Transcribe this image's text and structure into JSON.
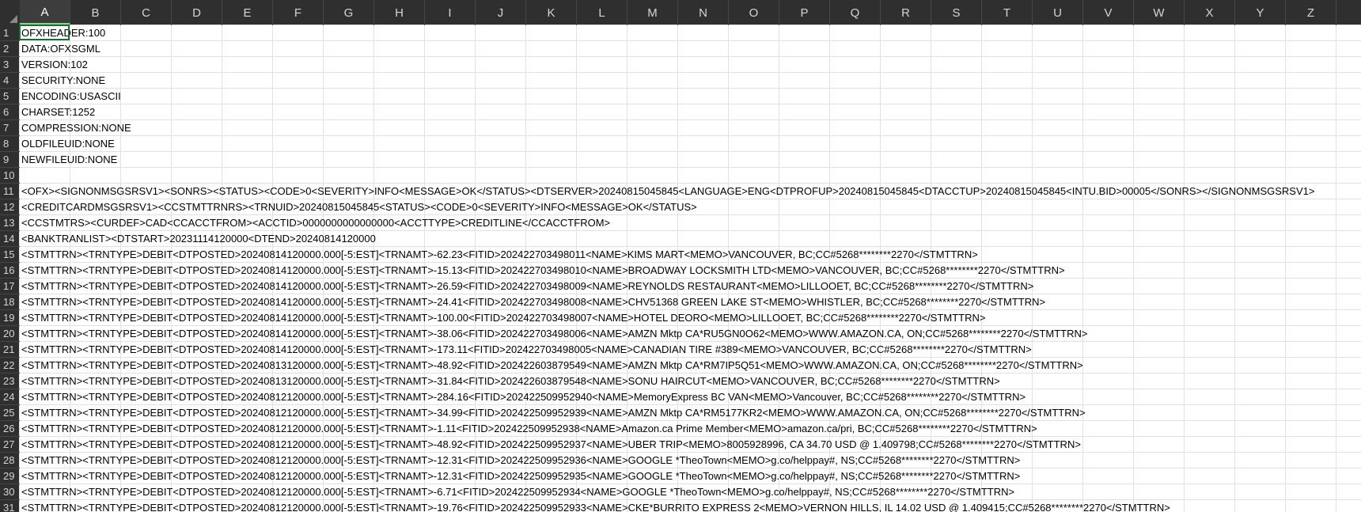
{
  "columns": [
    "A",
    "B",
    "C",
    "D",
    "E",
    "F",
    "G",
    "H",
    "I",
    "J",
    "K",
    "L",
    "M",
    "N",
    "O",
    "P",
    "Q",
    "R",
    "S",
    "T",
    "U",
    "V",
    "W",
    "X",
    "Y",
    "Z"
  ],
  "selected_column": "A",
  "selected_cell": "A1",
  "rows": [
    {
      "num": "1",
      "text": "OFXHEADER:100"
    },
    {
      "num": "2",
      "text": "DATA:OFXSGML"
    },
    {
      "num": "3",
      "text": "VERSION:102"
    },
    {
      "num": "4",
      "text": "SECURITY:NONE"
    },
    {
      "num": "5",
      "text": "ENCODING:USASCII"
    },
    {
      "num": "6",
      "text": "CHARSET:1252"
    },
    {
      "num": "7",
      "text": "COMPRESSION:NONE"
    },
    {
      "num": "8",
      "text": "OLDFILEUID:NONE"
    },
    {
      "num": "9",
      "text": "NEWFILEUID:NONE"
    },
    {
      "num": "10",
      "text": ""
    },
    {
      "num": "11",
      "text": "<OFX><SIGNONMSGSRSV1><SONRS><STATUS><CODE>0<SEVERITY>INFO<MESSAGE>OK</STATUS><DTSERVER>20240815045845<LANGUAGE>ENG<DTPROFUP>20240815045845<DTACCTUP>20240815045845<INTU.BID>00005</SONRS></SIGNONMSGSRSV1>"
    },
    {
      "num": "12",
      "text": "<CREDITCARDMSGSRSV1><CCSTMTTRNRS><TRNUID>20240815045845<STATUS><CODE>0<SEVERITY>INFO<MESSAGE>OK</STATUS>"
    },
    {
      "num": "13",
      "text": "<CCSTMTRS><CURDEF>CAD<CCACCTFROM><ACCTID>0000000000000000<ACCTTYPE>CREDITLINE</CCACCTFROM>"
    },
    {
      "num": "14",
      "text": "<BANKTRANLIST><DTSTART>20231114120000<DTEND>20240814120000"
    },
    {
      "num": "15",
      "text": "<STMTTRN><TRNTYPE>DEBIT<DTPOSTED>20240814120000.000[-5:EST]<TRNAMT>-62.23<FITID>202422703498011<NAME>KIMS MART<MEMO>VANCOUVER, BC;CC#5268********2270</STMTTRN>"
    },
    {
      "num": "16",
      "text": "<STMTTRN><TRNTYPE>DEBIT<DTPOSTED>20240814120000.000[-5:EST]<TRNAMT>-15.13<FITID>202422703498010<NAME>BROADWAY LOCKSMITH LTD<MEMO>VANCOUVER, BC;CC#5268********2270</STMTTRN>"
    },
    {
      "num": "17",
      "text": "<STMTTRN><TRNTYPE>DEBIT<DTPOSTED>20240814120000.000[-5:EST]<TRNAMT>-26.59<FITID>202422703498009<NAME>REYNOLDS RESTAURANT<MEMO>LILLOOET, BC;CC#5268********2270</STMTTRN>"
    },
    {
      "num": "18",
      "text": "<STMTTRN><TRNTYPE>DEBIT<DTPOSTED>20240814120000.000[-5:EST]<TRNAMT>-24.41<FITID>202422703498008<NAME>CHV51368 GREEN LAKE ST<MEMO>WHISTLER, BC;CC#5268********2270</STMTTRN>"
    },
    {
      "num": "19",
      "text": "<STMTTRN><TRNTYPE>DEBIT<DTPOSTED>20240814120000.000[-5:EST]<TRNAMT>-100.00<FITID>202422703498007<NAME>HOTEL DEORO<MEMO>LILLOOET, BC;CC#5268********2270</STMTTRN>"
    },
    {
      "num": "20",
      "text": "<STMTTRN><TRNTYPE>DEBIT<DTPOSTED>20240814120000.000[-5:EST]<TRNAMT>-38.06<FITID>202422703498006<NAME>AMZN Mktp CA*RU5GN0O62<MEMO>WWW.AMAZON.CA, ON;CC#5268********2270</STMTTRN>"
    },
    {
      "num": "21",
      "text": "<STMTTRN><TRNTYPE>DEBIT<DTPOSTED>20240814120000.000[-5:EST]<TRNAMT>-173.11<FITID>202422703498005<NAME>CANADIAN TIRE #389<MEMO>VANCOUVER, BC;CC#5268********2270</STMTTRN>"
    },
    {
      "num": "22",
      "text": "<STMTTRN><TRNTYPE>DEBIT<DTPOSTED>20240813120000.000[-5:EST]<TRNAMT>-48.92<FITID>202422603879549<NAME>AMZN Mktp CA*RM7IP5Q51<MEMO>WWW.AMAZON.CA, ON;CC#5268********2270</STMTTRN>"
    },
    {
      "num": "23",
      "text": "<STMTTRN><TRNTYPE>DEBIT<DTPOSTED>20240813120000.000[-5:EST]<TRNAMT>-31.84<FITID>202422603879548<NAME>SONU HAIRCUT<MEMO>VANCOUVER, BC;CC#5268********2270</STMTTRN>"
    },
    {
      "num": "24",
      "text": "<STMTTRN><TRNTYPE>DEBIT<DTPOSTED>20240812120000.000[-5:EST]<TRNAMT>-284.16<FITID>202422509952940<NAME>MemoryExpress BC VAN<MEMO>Vancouver, BC;CC#5268********2270</STMTTRN>"
    },
    {
      "num": "25",
      "text": "<STMTTRN><TRNTYPE>DEBIT<DTPOSTED>20240812120000.000[-5:EST]<TRNAMT>-34.99<FITID>202422509952939<NAME>AMZN Mktp CA*RM5177KR2<MEMO>WWW.AMAZON.CA, ON;CC#5268********2270</STMTTRN>"
    },
    {
      "num": "26",
      "text": "<STMTTRN><TRNTYPE>DEBIT<DTPOSTED>20240812120000.000[-5:EST]<TRNAMT>-1.11<FITID>202422509952938<NAME>Amazon.ca Prime Member<MEMO>amazon.ca/pri, BC;CC#5268********2270</STMTTRN>"
    },
    {
      "num": "27",
      "text": "<STMTTRN><TRNTYPE>DEBIT<DTPOSTED>20240812120000.000[-5:EST]<TRNAMT>-48.92<FITID>202422509952937<NAME>UBER TRIP<MEMO>8005928996, CA 34.70 USD @ 1.409798;CC#5268********2270</STMTTRN>"
    },
    {
      "num": "28",
      "text": "<STMTTRN><TRNTYPE>DEBIT<DTPOSTED>20240812120000.000[-5:EST]<TRNAMT>-12.31<FITID>202422509952936<NAME>GOOGLE *TheoTown<MEMO>g.co/helppay#, NS;CC#5268********2270</STMTTRN>"
    },
    {
      "num": "29",
      "text": "<STMTTRN><TRNTYPE>DEBIT<DTPOSTED>20240812120000.000[-5:EST]<TRNAMT>-12.31<FITID>202422509952935<NAME>GOOGLE *TheoTown<MEMO>g.co/helppay#, NS;CC#5268********2270</STMTTRN>"
    },
    {
      "num": "30",
      "text": "<STMTTRN><TRNTYPE>DEBIT<DTPOSTED>20240812120000.000[-5:EST]<TRNAMT>-6.71<FITID>202422509952934<NAME>GOOGLE *TheoTown<MEMO>g.co/helppay#, NS;CC#5268********2270</STMTTRN>"
    },
    {
      "num": "31",
      "text": "<STMTTRN><TRNTYPE>DEBIT<DTPOSTED>20240812120000.000[-5:EST]<TRNAMT>-19.76<FITID>202422509952933<NAME>CKE*BURRITO EXPRESS 2<MEMO>VERNON HILLS, IL 14.02 USD @ 1.409415;CC#5268********2270</STMTTRN>"
    }
  ]
}
